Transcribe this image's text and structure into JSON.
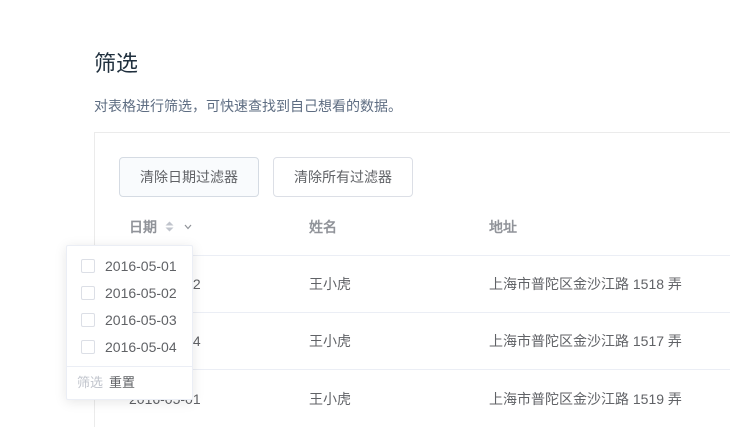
{
  "page": {
    "title": "筛选",
    "description": "对表格进行筛选，可快速查找到自己想看的数据。"
  },
  "toolbar": {
    "clear_date_filter_label": "清除日期过滤器",
    "clear_all_filters_label": "清除所有过滤器"
  },
  "table": {
    "columns": [
      {
        "label": "日期",
        "icons": [
          "sort-caret-icon",
          "chevron-down-icon"
        ]
      },
      {
        "label": "姓名"
      },
      {
        "label": "地址"
      }
    ],
    "rows": [
      {
        "date": "2016-05-02",
        "name": "王小虎",
        "address": "上海市普陀区金沙江路 1518 弄"
      },
      {
        "date": "2016-05-04",
        "name": "王小虎",
        "address": "上海市普陀区金沙江路 1517 弄"
      },
      {
        "date": "2016-05-01",
        "name": "王小虎",
        "address": "上海市普陀区金沙江路 1519 弄"
      }
    ]
  },
  "filter_popover": {
    "options": [
      {
        "label": "2016-05-01",
        "checked": false
      },
      {
        "label": "2016-05-02",
        "checked": false
      },
      {
        "label": "2016-05-03",
        "checked": false
      },
      {
        "label": "2016-05-04",
        "checked": false
      }
    ],
    "confirm_label": "筛选",
    "confirm_disabled": true,
    "reset_label": "重置"
  },
  "colors": {
    "title": "#1f2f3d",
    "description": "#5e6d82",
    "header_text": "#909399",
    "cell_text": "#606266",
    "border": "#ebeef5",
    "disabled_text": "#c0c4cc"
  }
}
